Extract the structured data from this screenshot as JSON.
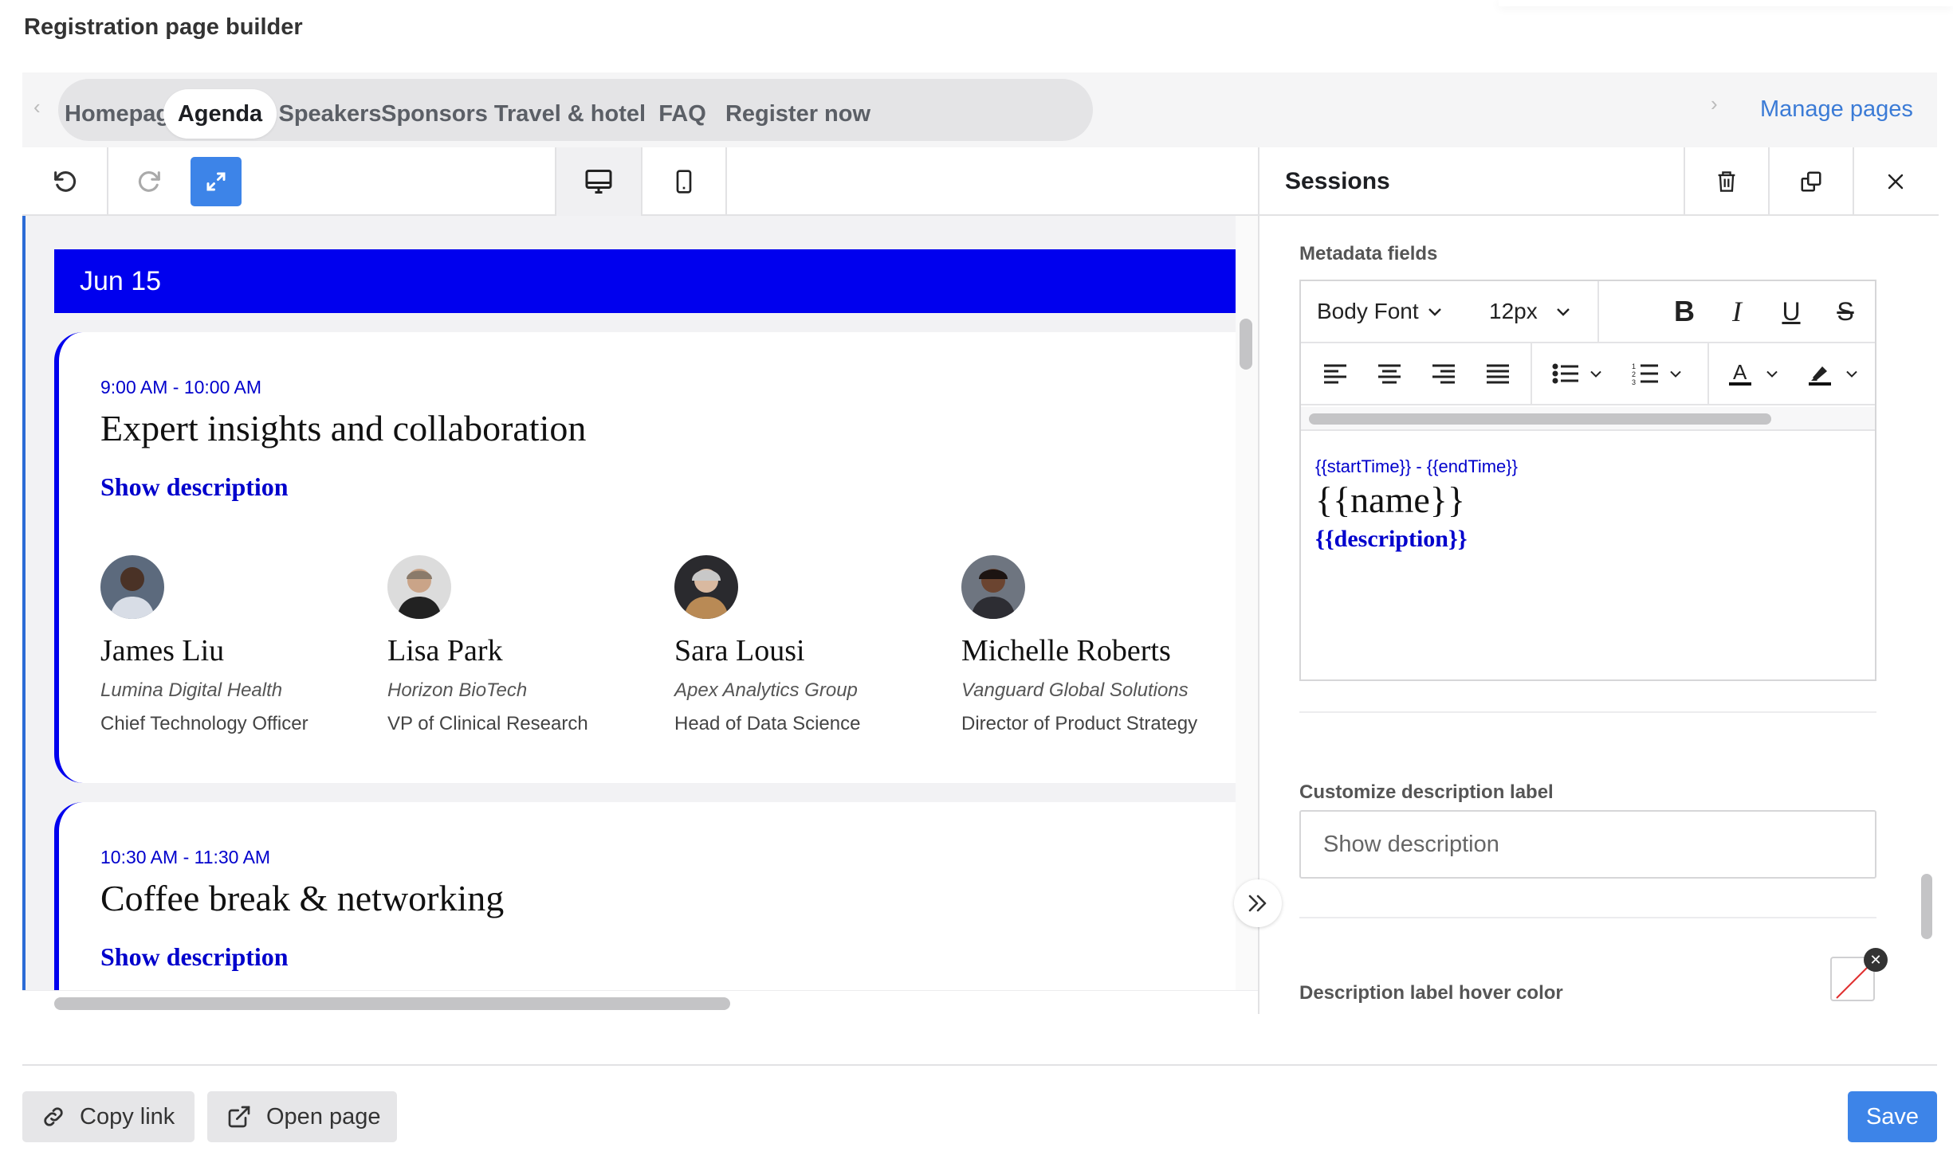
{
  "page": {
    "title": "Registration page builder"
  },
  "nav": {
    "tabs": [
      {
        "label": "Homepage"
      },
      {
        "label": "Agenda"
      },
      {
        "label": "Speakers"
      },
      {
        "label": "Sponsors"
      },
      {
        "label": "Travel & hotel"
      },
      {
        "label": "FAQ"
      },
      {
        "label": "Register now"
      }
    ],
    "active_tab": "Agenda",
    "manage_pages": "Manage pages"
  },
  "toolbar": {
    "icons": [
      "undo-icon",
      "redo-icon",
      "expand-icon",
      "desktop-icon",
      "mobile-icon"
    ]
  },
  "canvas": {
    "date": "Jun 15",
    "sessions": [
      {
        "time": "9:00 AM - 10:00 AM",
        "name": "Expert insights and collaboration",
        "show_label": "Show description",
        "speakers": [
          {
            "name": "James Liu",
            "company": "Lumina Digital Health",
            "title": "Chief Technology Officer"
          },
          {
            "name": "Lisa Park",
            "company": "Horizon BioTech",
            "title": "VP of Clinical Research"
          },
          {
            "name": "Sara Lousi",
            "company": "Apex Analytics Group",
            "title": "Head of Data Science"
          },
          {
            "name": "Michelle Roberts",
            "company": "Vanguard Global Solutions",
            "title": "Director of Product Strategy"
          }
        ]
      },
      {
        "time": "10:30 AM - 11:30 AM",
        "name": "Coffee break & networking",
        "show_label": "Show description"
      }
    ],
    "accent_color": "#0000EE"
  },
  "panel": {
    "title": "Sessions",
    "metadata_label": "Metadata fields",
    "editor": {
      "font": "Body Font",
      "size": "12px",
      "template_time": "{{startTime}} - {{endTime}}",
      "template_name": "{{name}}",
      "template_desc": "{{description}}"
    },
    "desc_label_title": "Customize description label",
    "desc_label_placeholder": "Show description",
    "hover_color_label": "Description label hover color"
  },
  "footer": {
    "copy_link": "Copy link",
    "open_page": "Open page",
    "save": "Save"
  },
  "colors": {
    "primary": "#3D84E8",
    "link": "#3B7BD6"
  }
}
